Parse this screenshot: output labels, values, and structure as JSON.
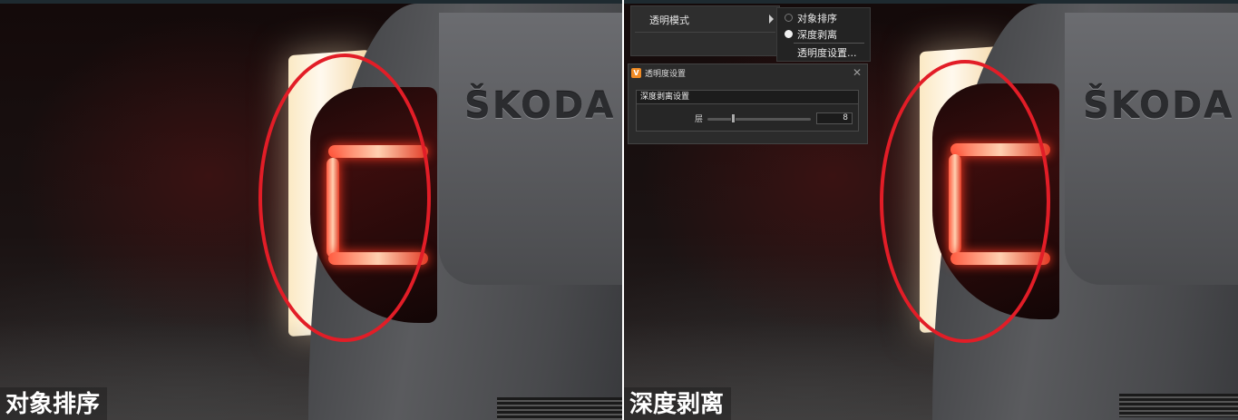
{
  "left_panel": {
    "caption": "对象排序",
    "brand_logo": "ŠKODA"
  },
  "right_panel": {
    "caption": "深度剥离",
    "brand_logo": "ŠKODA"
  },
  "menu": {
    "item_label": "透明模式",
    "submenu": {
      "options": [
        {
          "label": "对象排序",
          "selected": false
        },
        {
          "label": "深度剥离",
          "selected": true
        }
      ],
      "settings_label": "透明度设置..."
    }
  },
  "dialog": {
    "icon": "app-icon",
    "title": "透明度设置",
    "group_title": "深度剥离设置",
    "layer_label": "层",
    "slider_value_fraction": 0.25,
    "spin_value": "8"
  },
  "colors": {
    "highlight_ellipse": "#e21d27",
    "menu_bg": "#2e2e2e",
    "dialog_bg": "#2b2b2b"
  }
}
